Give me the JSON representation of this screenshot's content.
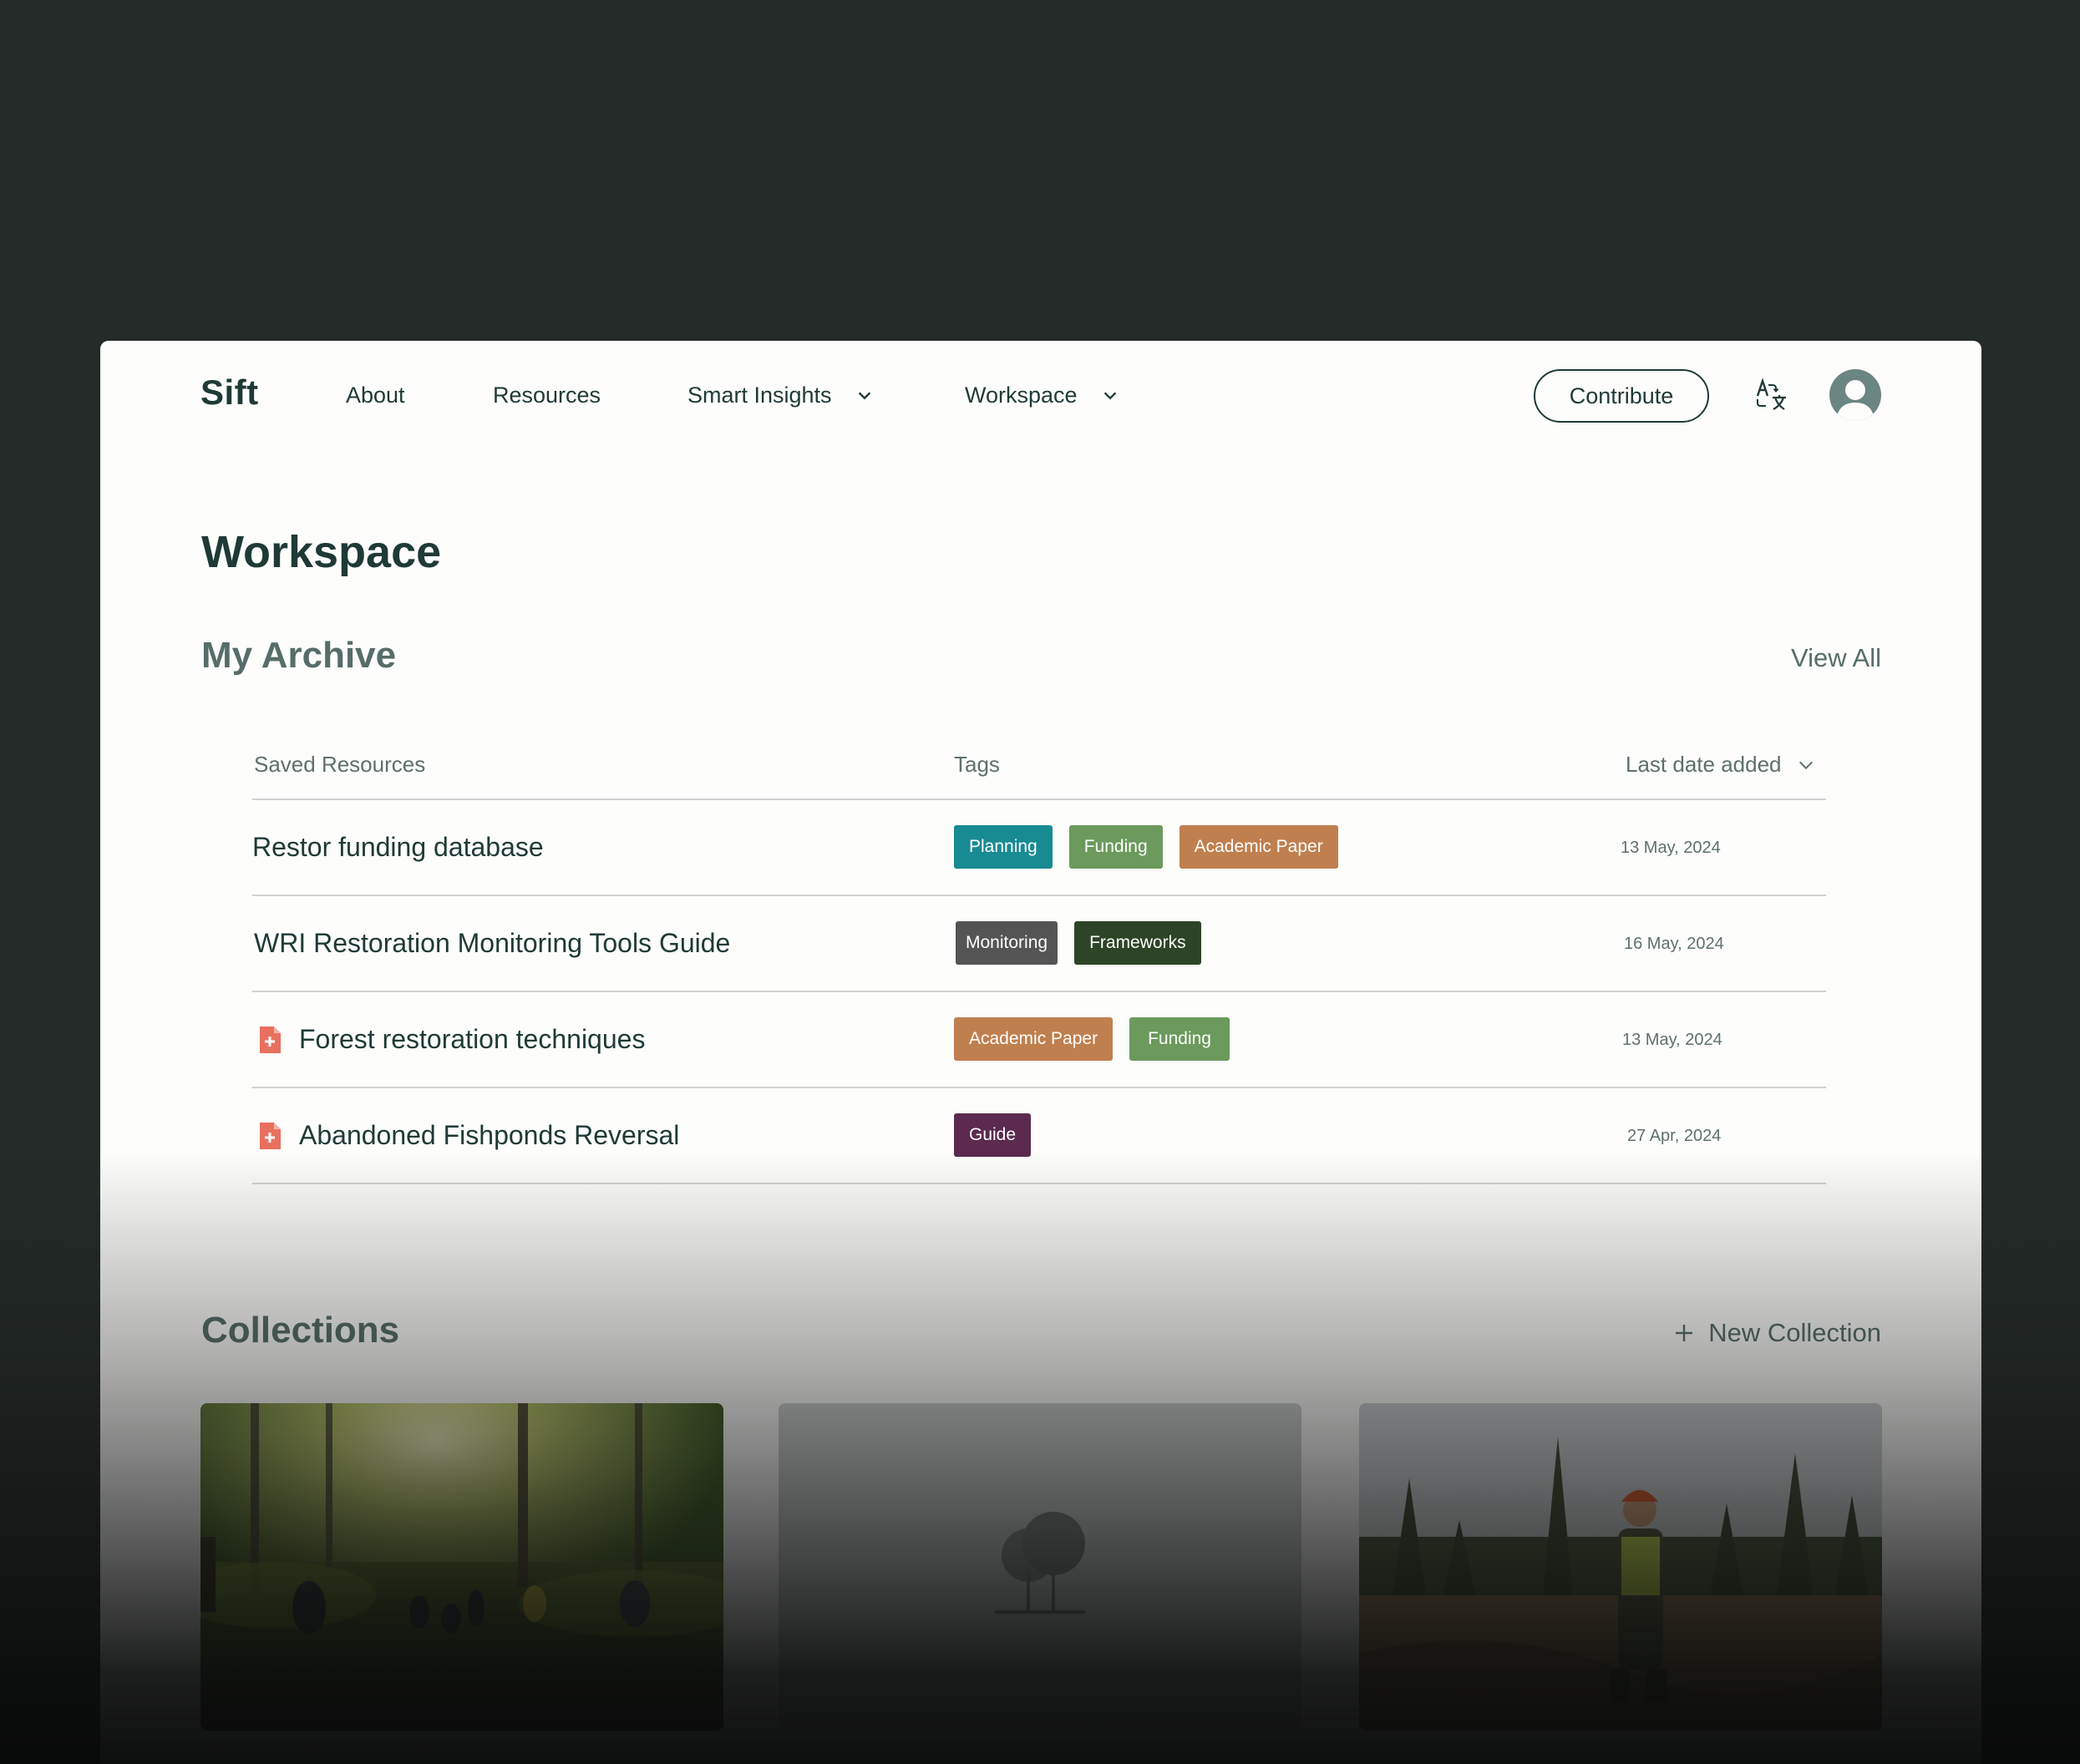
{
  "nav": {
    "logo": "Sift",
    "about": "About",
    "resources": "Resources",
    "smart_insights": "Smart Insights",
    "workspace": "Workspace",
    "contribute": "Contribute"
  },
  "page": {
    "title": "Workspace"
  },
  "archive": {
    "title": "My Archive",
    "view_all": "View All",
    "columns": {
      "saved": "Saved Resources",
      "tags": "Tags",
      "date": "Last date added"
    },
    "rows": [
      {
        "title": "Restor funding database",
        "date": "13 May, 2024",
        "tags": [
          "Planning",
          "Funding",
          "Academic Paper"
        ]
      },
      {
        "title": "WRI Restoration Monitoring Tools Guide",
        "date": "16 May, 2024",
        "tags": [
          "Monitoring",
          "Frameworks"
        ]
      },
      {
        "title": "Forest restoration techniques",
        "date": "13 May, 2024",
        "tags": [
          "Academic Paper",
          "Funding"
        ]
      },
      {
        "title": "Abandoned Fishponds Reversal",
        "date": "27 Apr, 2024",
        "tags": [
          "Guide"
        ]
      }
    ]
  },
  "collections": {
    "title": "Collections",
    "new_collection": "New Collection"
  },
  "colors": {
    "planning": "#188b92",
    "funding": "#6b9a5c",
    "academic_paper": "#c07f4f",
    "monitoring": "#545454",
    "frameworks": "#2d4526",
    "guide": "#5b2a4e"
  }
}
